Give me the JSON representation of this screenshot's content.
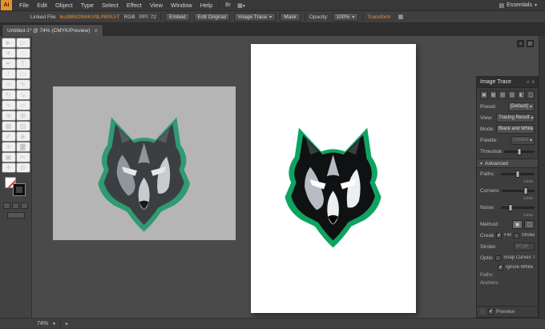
{
  "colors": {
    "accent_orange": "#e8913a",
    "trace_green": "#0fa361",
    "artboard_white": "#ffffff",
    "placed_bg_gray": "#b5b5b5"
  },
  "icons": {
    "caret_down": "▾",
    "caret_right": "▸",
    "close": "×",
    "check": "✓",
    "info": "ⓘ",
    "menu": "≡",
    "collapse": "«",
    "grid": "▦",
    "panel_list": "▤"
  },
  "menubar": {
    "logo_text": "Ai",
    "items": [
      "File",
      "Edit",
      "Object",
      "Type",
      "Select",
      "Effect",
      "View",
      "Window",
      "Help"
    ],
    "bridge_label": "Br",
    "workspace_switcher": "Essentials"
  },
  "controlbar": {
    "linked_file_label": "Linked File",
    "file_info": "6cd9B629WKV9LPBSUrT",
    "color_mode": "RGB",
    "ppi_label": "PPI: 72",
    "embed_button": "Embed",
    "edit_original_button": "Edit Original",
    "image_trace_button": "Image Trace",
    "mask_button": "Mask",
    "opacity_label": "Opacity:",
    "opacity_value": "100%",
    "transform_label": "Transform"
  },
  "document_tab": {
    "title": "Untitled-1* @ 74% (CMYK/Preview)"
  },
  "toolbar": {
    "tools": [
      {
        "name": "tool-selection",
        "glyph": "►"
      },
      {
        "name": "tool-direct-selection",
        "glyph": "▷"
      },
      {
        "name": "tool-magic-wand",
        "glyph": "✶"
      },
      {
        "name": "tool-lasso",
        "glyph": "◌"
      },
      {
        "name": "tool-pen",
        "glyph": "✒"
      },
      {
        "name": "tool-type",
        "glyph": "T"
      },
      {
        "name": "tool-line",
        "glyph": "/"
      },
      {
        "name": "tool-rectangle",
        "glyph": "▭"
      },
      {
        "name": "tool-paintbrush",
        "glyph": "✑"
      },
      {
        "name": "tool-pencil",
        "glyph": "✎"
      },
      {
        "name": "tool-rotate",
        "glyph": "↻"
      },
      {
        "name": "tool-scale",
        "glyph": "↘"
      },
      {
        "name": "tool-width",
        "glyph": "∿"
      },
      {
        "name": "tool-free-transform",
        "glyph": "▱"
      },
      {
        "name": "tool-shape-builder",
        "glyph": "⊕"
      },
      {
        "name": "tool-perspective-grid",
        "glyph": "⊞"
      },
      {
        "name": "tool-mesh",
        "glyph": "▦"
      },
      {
        "name": "tool-gradient",
        "glyph": "▥"
      },
      {
        "name": "tool-eyedropper",
        "glyph": "✐"
      },
      {
        "name": "tool-blend",
        "glyph": "◈"
      },
      {
        "name": "tool-symbol-sprayer",
        "glyph": "✳"
      },
      {
        "name": "tool-column-graph",
        "glyph": "▇"
      },
      {
        "name": "tool-artboard",
        "glyph": "▣"
      },
      {
        "name": "tool-slice",
        "glyph": "✂"
      },
      {
        "name": "tool-hand",
        "glyph": "✛"
      },
      {
        "name": "tool-zoom",
        "glyph": "⊙"
      }
    ]
  },
  "image_trace_panel": {
    "title": "Image Trace",
    "preset_buttons": [
      {
        "name": "trace-preset-auto-color",
        "glyph": "▣"
      },
      {
        "name": "trace-preset-high-color",
        "glyph": "▩"
      },
      {
        "name": "trace-preset-low-color",
        "glyph": "▨"
      },
      {
        "name": "trace-preset-grayscale",
        "glyph": "▥"
      },
      {
        "name": "trace-preset-black-white",
        "glyph": "◧"
      },
      {
        "name": "trace-preset-outline",
        "glyph": "▢"
      }
    ],
    "preset_label": "Preset:",
    "preset_value": "[Default]",
    "view_label": "View:",
    "view_value": "Tracing Result",
    "mode_label": "Mode:",
    "mode_value": "Black and White",
    "palette_label": "Palette:",
    "palette_value": "Limited",
    "threshold_label": "Threshold:",
    "advanced_label": "Advanced",
    "paths_label": "Paths:",
    "paths_hint": "Less",
    "corners_label": "Corners:",
    "corners_hint": "Less",
    "noise_label": "Noise:",
    "noise_hint": "Less",
    "method_label": "Method:",
    "create_label": "Create:",
    "fills_label": "Fills",
    "strokes_label": "Strokes",
    "stroke_label": "Stroke:",
    "stroke_value": "50 px",
    "options_label": "Options:",
    "snap_curves_label": "Snap Curves To Lines",
    "ignore_white_label": "Ignore White",
    "paths_info_label": "Paths:",
    "anchors_info_label": "Anchors:",
    "preview_label": "Preview"
  },
  "statusbar": {
    "zoom": "74%"
  }
}
